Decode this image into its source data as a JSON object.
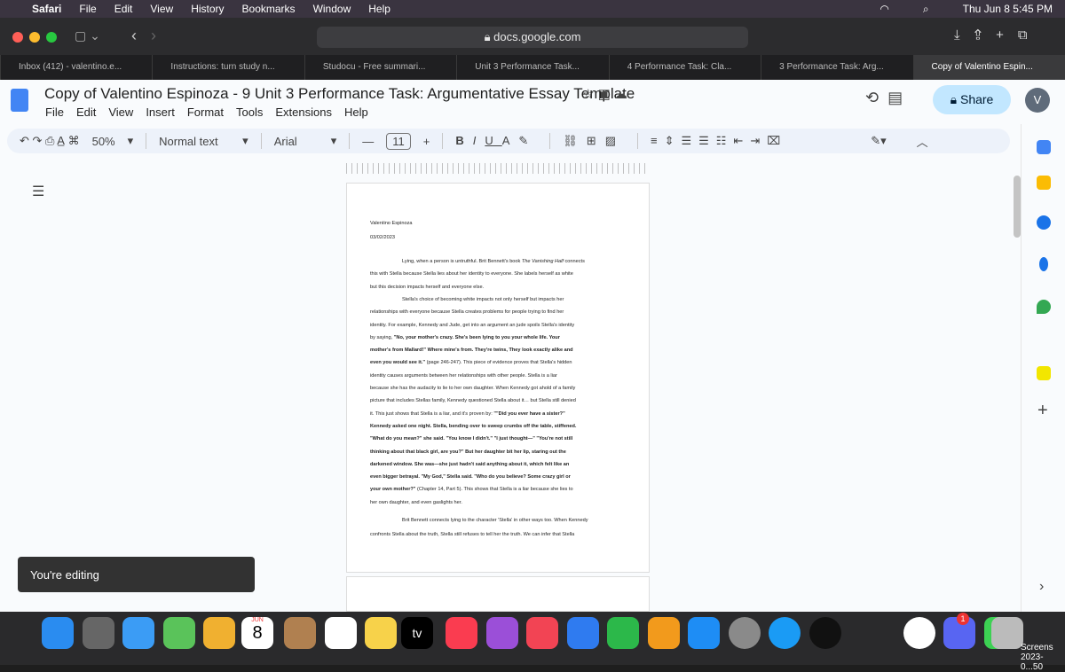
{
  "menubar": {
    "app": "Safari",
    "items": [
      "File",
      "Edit",
      "View",
      "History",
      "Bookmarks",
      "Window",
      "Help"
    ],
    "clock": "Thu Jun 8  5:45 PM"
  },
  "safari": {
    "url": "docs.google.com",
    "tabs": [
      "Inbox (412) - valentino.e...",
      "Instructions: turn study n...",
      "Studocu - Free summari...",
      "Unit 3 Performance Task...",
      "4 Performance Task: Cla...",
      "3 Performance Task: Arg...",
      "Copy of Valentino Espin..."
    ]
  },
  "docs": {
    "title": "Copy of Valentino Espinoza - 9 Unit 3 Performance Task: Argumentative Essay Template",
    "menu": [
      "File",
      "Edit",
      "View",
      "Insert",
      "Format",
      "Tools",
      "Extensions",
      "Help"
    ],
    "share": "Share",
    "avatar": "V",
    "toolbar": {
      "zoom": "50%",
      "style": "Normal text",
      "font": "Arial",
      "size": "11"
    },
    "toast": "You're editing"
  },
  "document": {
    "lines": [
      [
        {
          "t": "Valentino Espinoza"
        }
      ],
      [
        {
          "t": "03/02/2023"
        }
      ],
      [
        {
          "t": "Lying, when a person is untruthful. Brit Bennett's book "
        },
        {
          "t": "The Vanishing Half",
          "i": true
        },
        {
          "t": " connects"
        }
      ],
      [
        {
          "t": "this with Stella because Stella lies about her identity to everyone. She labels herself as white"
        }
      ],
      [
        {
          "t": "but this decision impacts herself and everyone else."
        }
      ],
      [
        {
          "t": "Stella's choice of becoming white impacts not only herself but impacts her"
        }
      ],
      [
        {
          "t": "relationships with everyone because Stella creates problems for people trying to find her"
        }
      ],
      [
        {
          "t": "identity. For example, Kennedy and Jude, get into an argument an jude spoils Stella's identity"
        }
      ],
      [
        {
          "t": "by saying, "
        },
        {
          "t": "\"No, your mother's crazy. She's been lying to you your whole life. Your",
          "b": true
        }
      ],
      [
        {
          "t": "mother's from Mallard!\" Where mine's from. They're twins, They look exactly alike and",
          "b": true
        }
      ],
      [
        {
          "t": "even you would see it.\"",
          "b": true
        },
        {
          "t": " (page 246-247). This piece of evidence proves that Stella's hidden"
        }
      ],
      [
        {
          "t": "identity causes arguments between her relationships with other people. Stella is a liar"
        }
      ],
      [
        {
          "t": "because she has the audacity to lie to her own daughter. When Kennedy got ahold of a family"
        }
      ],
      [
        {
          "t": "picture that includes Stellas family, Kennedy questioned Stella about it… but Stella still denied"
        }
      ],
      [
        {
          "t": "it. This just shows that Stella is a liar, and it's proven by: "
        },
        {
          "t": "\"\"Did you ever have a sister?\"",
          "b": true
        }
      ],
      [
        {
          "t": "Kennedy asked one night. Stella, bending over to sweep crumbs off the table, stiffened.",
          "b": true
        }
      ],
      [
        {
          "t": "\"What do you mean?\" she said. \"You know I didn't.\" \"I just thought—\" \"You're not still",
          "b": true
        }
      ],
      [
        {
          "t": "thinking about that black girl, are you?\" But her daughter bit her lip, staring out the",
          "b": true
        }
      ],
      [
        {
          "t": "darkened window. She was—she just hadn't said anything about it, which felt like an",
          "b": true
        }
      ],
      [
        {
          "t": "even bigger betrayal. \"My God,\" Stella said. \"Who do you believe? Some crazy girl or",
          "b": true
        }
      ],
      [
        {
          "t": "your own mother?\"",
          "b": true
        },
        {
          "t": " (Chapter 14, Part 5). This shows that Stella is a liar because she lies to"
        }
      ],
      [
        {
          "t": "her own daughter, and even gaslights her."
        }
      ],
      [
        {
          "t": "Brit Bennett connects lying to the character 'Stella' in other ways too. When Kennedy"
        }
      ],
      [
        {
          "t": "confronts Stella about the truth, Stella still refuses to tell her the truth. We can infer that Stella"
        }
      ]
    ]
  },
  "dock": {
    "calendar_month": "JUN",
    "calendar_day": "8",
    "tv": "tv",
    "badge_1": "1",
    "screenshot_label": "Screens",
    "screenshot_label2": "2023-0...50"
  }
}
